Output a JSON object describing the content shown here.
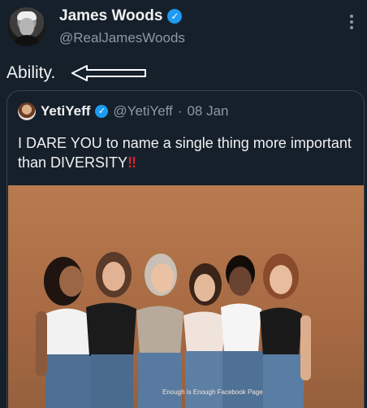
{
  "author": {
    "name": "James Woods",
    "handle": "@RealJamesWoods",
    "verified": true
  },
  "tweet": {
    "text": "Ability."
  },
  "quoted": {
    "name": "YetiYeff",
    "handle": "@YetiYeff",
    "separator": "·",
    "date": "08 Jan",
    "text": "I DARE YOU to name a single thing more important than DIVERSITY",
    "emoji": "‼",
    "image_credit": "Enough is Enough Facebook Page"
  },
  "colors": {
    "background": "#15202b",
    "verified": "#1d9bf0",
    "secondary_text": "#8b98a5",
    "border": "#38444d",
    "photo_background": "#a86a43"
  },
  "icons": [
    "verified-badge-icon",
    "more-options-icon",
    "arrow-icon"
  ]
}
